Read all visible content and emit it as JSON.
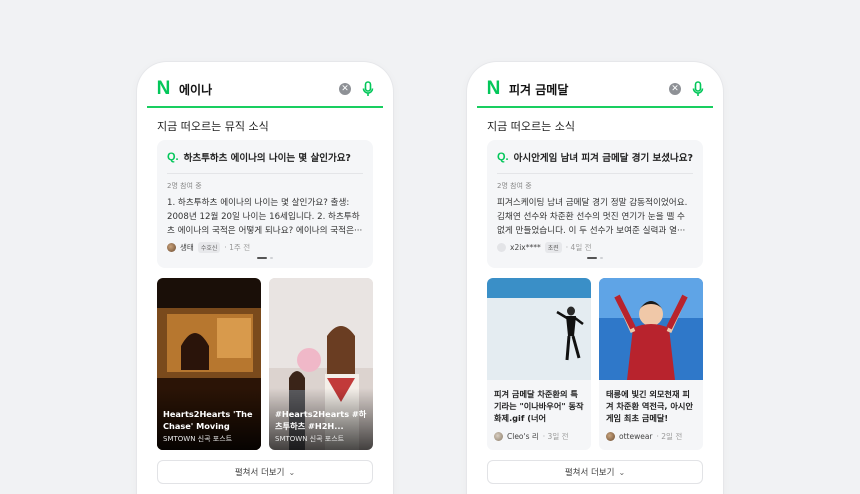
{
  "left": {
    "search": {
      "query": "에이나"
    },
    "section_title": "지금 떠오르는 뮤직 소식",
    "qa": {
      "question": "하츠투하츠 에이나의 나이는 몇 살인가요?",
      "count": "2명 참여 중",
      "answer": "1. 하츠투하츠 에이나의 나이는 몇 살인가요? 출생: 2008년 12월 20일 나이는 16세입니다. 2. 하츠투하츠 에이나의 국적은 어떻게 되나요? 에이나의 국적은···",
      "user": "생태",
      "badge": "수호신",
      "time": "· 1주 전"
    },
    "cards": [
      {
        "title": "Hearts2Hearts 'The Chase' Moving Clip...",
        "source": "SMTOWN 신곡 포스트"
      },
      {
        "title": "#Hearts2Hearts #하츠투하츠 #H2H...",
        "source": "SMTOWN 신곡 포스트"
      }
    ],
    "more_label": "펼쳐서 더보기"
  },
  "right": {
    "search": {
      "query": "피겨 금메달"
    },
    "section_title": "지금 떠오르는 소식",
    "qa": {
      "question": "아시안게임 남녀 피겨 금메달 경기 보셨나요?",
      "count": "2명 참여 중",
      "answer": "피겨스케이팅 남녀 금메달 경기 정말 감동적이었어요. 김채연 선수와 차준환 선수의 멋진 연기가 눈을 뗄 수 없게 만들었습니다. 이 두 선수가 보여준 실력과 열···",
      "user": "x2ix****",
      "badge": "초련",
      "time": "· 4일 전"
    },
    "cards": [
      {
        "title": "피겨 금메달 차준환의 특기라는 \"이나바우어\" 동작 화제.gif (너어",
        "source": "Cleo's 리",
        "time": "· 3일 전"
      },
      {
        "title": "태릉에 빛긴 외모천재 피겨 차준환 역전극, 아시안게임 최초 금메달!",
        "source": "ottewear",
        "time": "· 2일 전"
      }
    ],
    "more_label": "펼쳐서 더보기"
  },
  "colors": {
    "brand_green": "#03c75a",
    "background": "#f1f2f4"
  },
  "icons": [
    "naver-logo-icon",
    "clear-icon",
    "mic-icon",
    "q-search-icon",
    "chevron-down-icon"
  ]
}
